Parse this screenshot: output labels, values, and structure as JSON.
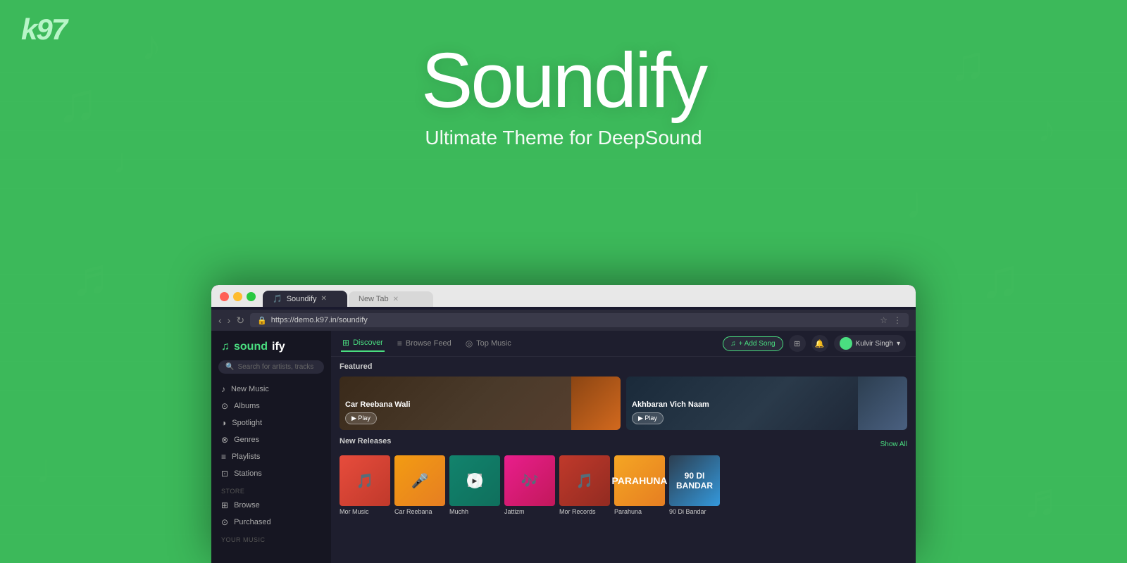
{
  "background": {
    "color": "#3cb95a"
  },
  "top_logo": {
    "text_k": "k",
    "text_97": "97"
  },
  "hero": {
    "title": "Soundify",
    "subtitle": "Ultimate Theme for DeepSound"
  },
  "browser": {
    "tab_active": "Soundify",
    "tab_inactive": "New Tab",
    "address": "https://demo.k97.in/soundify"
  },
  "app": {
    "logo": "soundify",
    "logo_colored": "sound",
    "logo_plain": "ify",
    "search_placeholder": "Search for artists, tracks",
    "nav_tabs": [
      {
        "id": "discover",
        "label": "Discover",
        "icon": "⊞",
        "active": true
      },
      {
        "id": "browse-feed",
        "label": "Browse Feed",
        "icon": "≡",
        "active": false
      },
      {
        "id": "top-music",
        "label": "Top Music",
        "icon": "◎",
        "active": false
      }
    ],
    "add_song_label": "+ Add Song",
    "user_name": "Kulvir Singh",
    "sidebar": {
      "nav_items": [
        {
          "id": "new-music",
          "label": "New Music",
          "icon": "♪"
        },
        {
          "id": "albums",
          "label": "Albums",
          "icon": "⊙"
        },
        {
          "id": "spotlight",
          "label": "Spotlight",
          "icon": "◑"
        },
        {
          "id": "genres",
          "label": "Genres",
          "icon": "⊗"
        },
        {
          "id": "playlists",
          "label": "Playlists",
          "icon": "≡"
        },
        {
          "id": "stations",
          "label": "Stations",
          "icon": "⊡"
        }
      ],
      "store_section": "STORE",
      "store_items": [
        {
          "id": "browse",
          "label": "Browse",
          "icon": "⊞"
        },
        {
          "id": "purchased",
          "label": "Purchased",
          "icon": "⊙"
        }
      ],
      "your_music_section": "YOUR MUSIC"
    },
    "featured_section": "Featured",
    "featured_cards": [
      {
        "id": "card1",
        "title": "Car Reebana Wali",
        "play_label": "▶ Play",
        "color_class": "featured-card-1",
        "thumb_class": "featured-card-thumb-1"
      },
      {
        "id": "card2",
        "title": "Akhbaran Vich Naam",
        "play_label": "▶ Play",
        "color_class": "featured-card-2",
        "thumb_class": "featured-card-thumb-2"
      }
    ],
    "releases_section": "New Releases",
    "show_all_label": "Show All",
    "releases": [
      {
        "id": "r1",
        "title": "Mor Music",
        "color_class": "rc1"
      },
      {
        "id": "r2",
        "title": "Car Reebana",
        "color_class": "rc2"
      },
      {
        "id": "r3",
        "title": "Muchh",
        "color_class": "rc3",
        "has_play": true
      },
      {
        "id": "r4",
        "title": "Jattizm",
        "color_class": "rc4"
      },
      {
        "id": "r5",
        "title": "Mor Records",
        "color_class": "rc5"
      },
      {
        "id": "r6",
        "title": "Parahuna",
        "color_class": "rc6"
      },
      {
        "id": "r7",
        "title": "90 Di Bandar",
        "color_class": "rc7"
      }
    ]
  }
}
